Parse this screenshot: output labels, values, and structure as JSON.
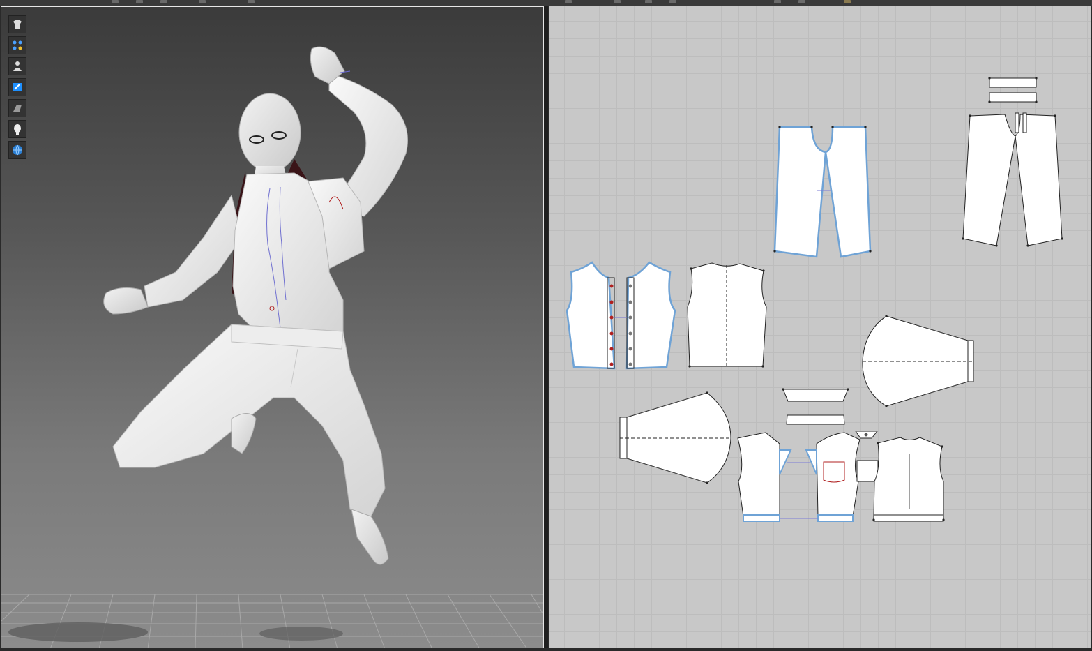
{
  "window": {
    "left_panel": "3d-garment-viewport",
    "right_panel": "2d-pattern-window"
  },
  "toolbar3d": {
    "tools": [
      {
        "name": "garment-display-icon"
      },
      {
        "name": "particle-distance-icon"
      },
      {
        "name": "avatar-display-icon"
      },
      {
        "name": "fabric-render-icon"
      },
      {
        "name": "texture-surface-icon"
      },
      {
        "name": "avatar-head-icon"
      },
      {
        "name": "environment-globe-icon"
      }
    ]
  },
  "colors": {
    "viewport_top": "#3b3b3b",
    "viewport_bottom": "#8c8c8c",
    "pattern_bg": "#c8c8c8",
    "pattern_fill": "#ffffff",
    "selected_outline": "#6fa3d6",
    "seam_line": "#7b7bd6",
    "pocket_line": "#b02020",
    "lining_dark": "#3a1418"
  },
  "patterns": [
    {
      "id": "pants-front"
    },
    {
      "id": "pants-back"
    },
    {
      "id": "waistband-1"
    },
    {
      "id": "waistband-2"
    },
    {
      "id": "shirt-front"
    },
    {
      "id": "shirt-back"
    },
    {
      "id": "shirt-sleeve-right"
    },
    {
      "id": "jacket-sleeve-left"
    },
    {
      "id": "jacket-collar-1"
    },
    {
      "id": "jacket-collar-2"
    },
    {
      "id": "jacket-front"
    },
    {
      "id": "jacket-pocket"
    },
    {
      "id": "jacket-back"
    }
  ]
}
